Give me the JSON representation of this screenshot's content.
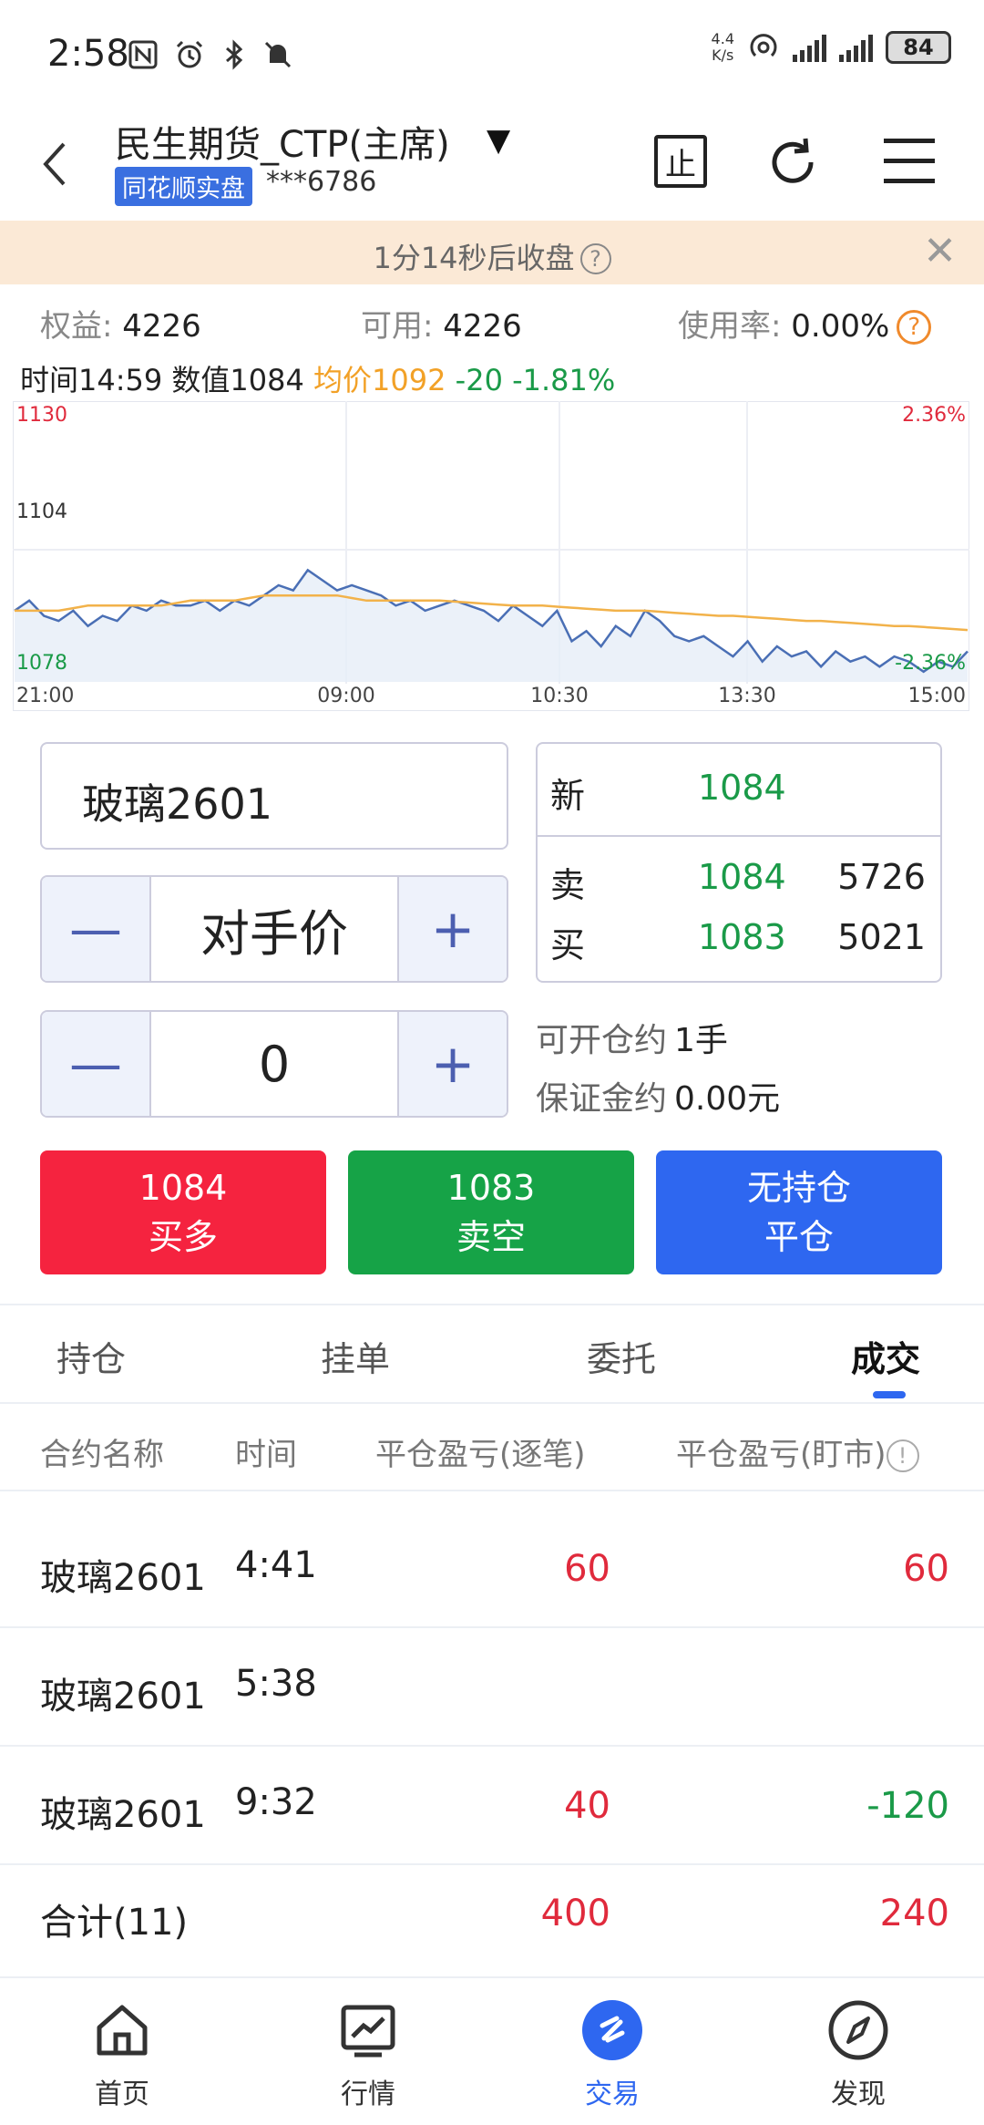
{
  "status_bar": {
    "time": "2:58",
    "left_icons": [
      "nfc-icon",
      "alarm-icon",
      "bluetooth-icon",
      "mute-icon"
    ],
    "net_speed_value": "4.4",
    "net_speed_unit": "K/s",
    "battery": "84"
  },
  "header": {
    "broker_name": "民生期货_CTP(主席)",
    "platform_badge": "同花顺实盘",
    "account_no": "***6786",
    "stop_icon_label": "止"
  },
  "notice": {
    "text": "1分14秒后收盘",
    "help": "?",
    "close": "✕"
  },
  "summary": {
    "equity_label": "权益:",
    "equity_value": "4226",
    "available_label": "可用:",
    "available_value": "4226",
    "usage_label": "使用率:",
    "usage_value": "0.00%",
    "help": "?"
  },
  "quote_line": {
    "time_label": "时间",
    "time_value": "14:59",
    "value_label": "数值",
    "value": "1084",
    "avg_label": "均价",
    "avg_value": "1092",
    "change": "-20",
    "change_pct": "-1.81%"
  },
  "chart_data": {
    "type": "line",
    "y_left_ticks": [
      "1130",
      "1104",
      "1078"
    ],
    "y_right_ticks": [
      "2.36%",
      "-2.36%"
    ],
    "x_ticks": [
      "21:00",
      "09:00",
      "10:30",
      "13:30",
      "15:00"
    ],
    "ylim": [
      1078,
      1130
    ],
    "grid": true,
    "series": [
      {
        "color": "#4a6fb5",
        "values": [
          1092,
          1094,
          1091,
          1090,
          1092,
          1089,
          1091,
          1090,
          1093,
          1092,
          1094,
          1093,
          1093,
          1094,
          1092,
          1094,
          1093,
          1095,
          1097,
          1096,
          1100,
          1098,
          1096,
          1097,
          1096,
          1095,
          1093,
          1094,
          1092,
          1093,
          1094,
          1093,
          1092,
          1090,
          1093,
          1091,
          1089,
          1092,
          1086,
          1088,
          1085,
          1089,
          1087,
          1092,
          1090,
          1087,
          1086,
          1087,
          1085,
          1083,
          1086,
          1082,
          1085,
          1083,
          1084,
          1081,
          1084,
          1082,
          1083,
          1081,
          1083,
          1082,
          1080,
          1082,
          1081,
          1084
        ]
      },
      {
        "color": "#f2b24a",
        "values": [
          1092,
          1092,
          1092,
          1092,
          1092.5,
          1093,
          1093,
          1093,
          1093,
          1093,
          1093,
          1093.5,
          1094,
          1094,
          1094,
          1094,
          1094.5,
          1095,
          1095,
          1095,
          1095,
          1095,
          1095,
          1094.5,
          1094,
          1094,
          1094,
          1094,
          1094,
          1094,
          1093.8,
          1093.6,
          1093.4,
          1093.2,
          1093,
          1093,
          1093,
          1092.8,
          1092.6,
          1092.4,
          1092.2,
          1092,
          1092,
          1092,
          1091.8,
          1091.6,
          1091.4,
          1091.2,
          1091,
          1091,
          1090.8,
          1090.6,
          1090.4,
          1090.2,
          1090,
          1090,
          1089.8,
          1089.6,
          1089.4,
          1089.2,
          1089,
          1089,
          1088.8,
          1088.6,
          1088.4,
          1088.2
        ]
      }
    ]
  },
  "order": {
    "contract": "玻璃2601",
    "price_type": "对手价",
    "quantity": "0",
    "minus": "—",
    "plus": "+"
  },
  "quote_box": {
    "last_label": "新",
    "last_price": "1084",
    "ask_label": "卖",
    "ask_price": "1084",
    "ask_volume": "5726",
    "bid_label": "买",
    "bid_price": "1083",
    "bid_volume": "5021"
  },
  "availability": {
    "open_label": "可开仓约",
    "open_value": "1手",
    "margin_label": "保证金约",
    "margin_value": "0.00元"
  },
  "actions": {
    "buy_price": "1084",
    "buy_label": "买多",
    "sell_price": "1083",
    "sell_label": "卖空",
    "close_top": "无持仓",
    "close_label": "平仓"
  },
  "tabs": [
    "持仓",
    "挂单",
    "委托",
    "成交"
  ],
  "table": {
    "headers": [
      "合约名称",
      "时间",
      "平仓盈亏(逐笔)",
      "平仓盈亏(盯市)"
    ],
    "info": "!",
    "rows": [
      {
        "name": "玻璃2601",
        "time": "4:41",
        "pnl_trade": "60",
        "pnl_mark": "60",
        "trade_color": "#e02a3c",
        "mark_color": "#e02a3c"
      },
      {
        "name": "玻璃2601",
        "time": "5:38",
        "pnl_trade": "",
        "pnl_mark": "",
        "trade_color": "#e02a3c",
        "mark_color": "#e02a3c"
      },
      {
        "name": "玻璃2601",
        "time": "9:32",
        "pnl_trade": "40",
        "pnl_mark": "-120",
        "trade_color": "#e02a3c",
        "mark_color": "#1a9a48"
      }
    ],
    "total_label": "合计(11)",
    "total_trade": "400",
    "total_mark": "240"
  },
  "bottom_nav": [
    {
      "label": "首页",
      "icon": "home-icon"
    },
    {
      "label": "行情",
      "icon": "chart-icon"
    },
    {
      "label": "交易",
      "icon": "trade-icon"
    },
    {
      "label": "发现",
      "icon": "compass-icon"
    }
  ]
}
